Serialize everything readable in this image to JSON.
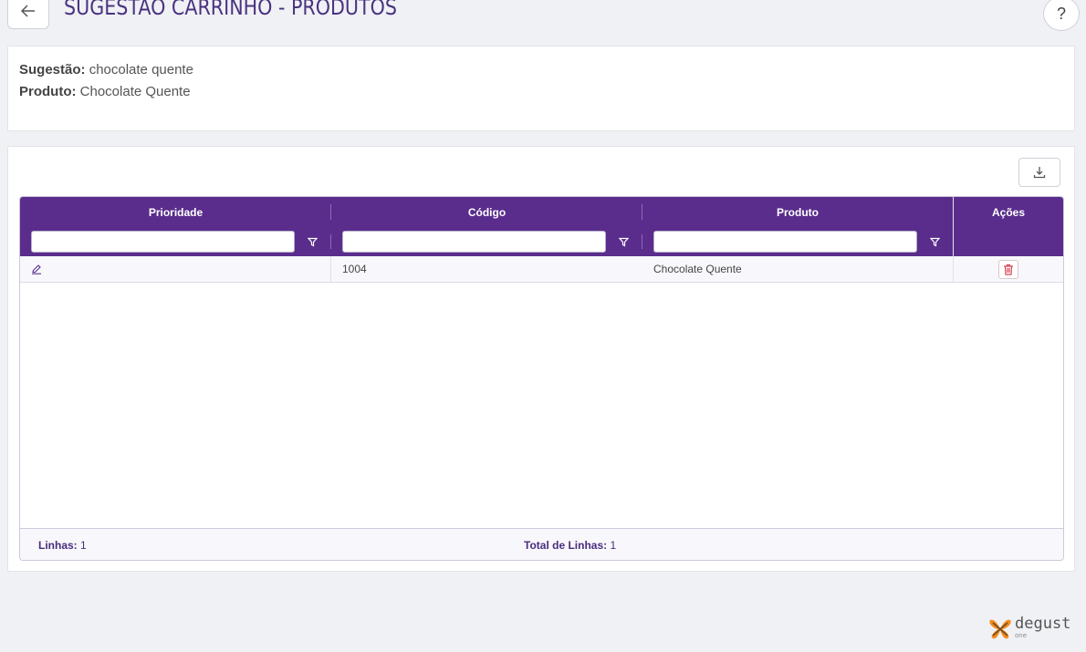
{
  "header": {
    "title": "SUGESTÃO CARRINHO - PRODUTOS",
    "help_label": "?"
  },
  "info": {
    "sugestao_label": "Sugestão:",
    "sugestao_value": "chocolate quente",
    "produto_label": "Produto:",
    "produto_value": "Chocolate Quente"
  },
  "grid": {
    "columns": [
      "Prioridade",
      "Código",
      "Produto",
      "Ações"
    ],
    "filters": [
      {
        "value": "",
        "placeholder": ""
      },
      {
        "value": "",
        "placeholder": ""
      },
      {
        "value": "",
        "placeholder": ""
      }
    ],
    "rows": [
      {
        "prioridade": "",
        "codigo": "1004",
        "produto": "Chocolate Quente"
      }
    ],
    "footer": {
      "linhas_label": "Linhas:",
      "linhas_value": "1",
      "total_label": "Total de Linhas:",
      "total_value": "1"
    }
  },
  "icons": {
    "back": "arrow-left-icon",
    "help": "question-icon",
    "export": "download-icon",
    "filter": "filter-icon",
    "edit": "pencil-icon",
    "delete": "trash-icon"
  },
  "colors": {
    "accent": "#5a2d8c",
    "title": "#4a3380",
    "delete": "#d9434f",
    "logo_orange": "#f28c1e"
  },
  "brand": {
    "name": "degust",
    "sub": "one"
  }
}
